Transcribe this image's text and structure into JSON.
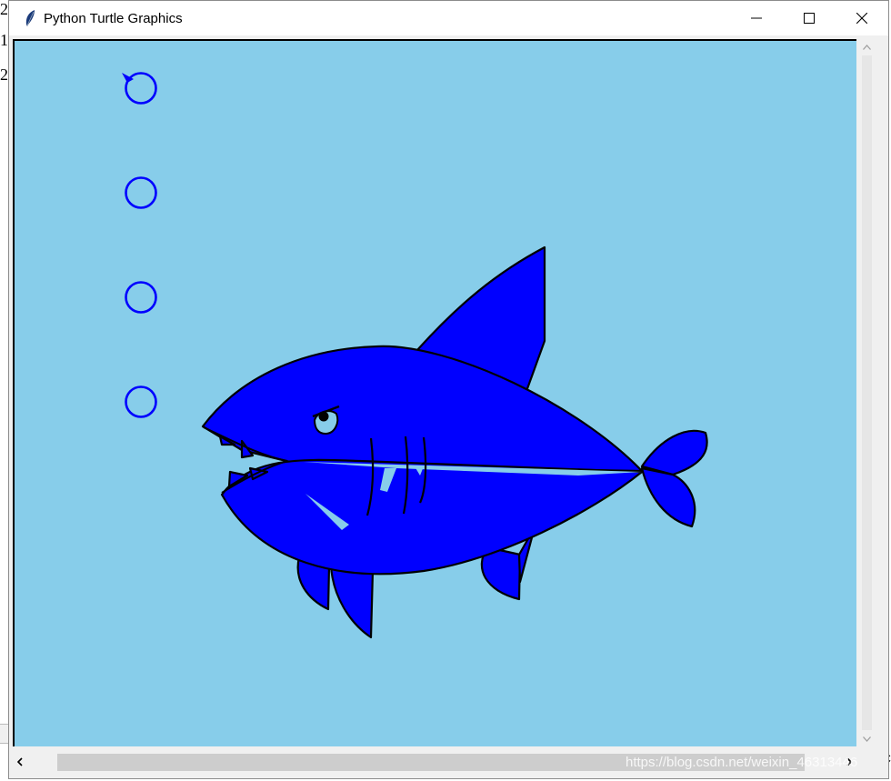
{
  "background": {
    "line1": "2",
    "line2": "1",
    "line3": "2",
    "right_fragment": "C"
  },
  "window": {
    "title": "Python Turtle Graphics",
    "icon": "feather-icon",
    "controls": [
      "minimize-icon",
      "maximize-icon",
      "close-icon"
    ]
  },
  "canvas": {
    "background_color": "#87CDEA",
    "fill_color": "#0000FF",
    "outline_color": "#000000",
    "highlight_color": "#87CDEA",
    "bubble_count": 4,
    "bubble_color": "#0000FF"
  },
  "scrollbars": {
    "left_arrow": "chevron-left-icon",
    "right_arrow": "chevron-right-icon",
    "up_arrow": "chevron-up-icon",
    "down_arrow": "chevron-down-icon"
  },
  "watermark": {
    "text": "https://blog.csdn.net/weixin_46313446"
  }
}
